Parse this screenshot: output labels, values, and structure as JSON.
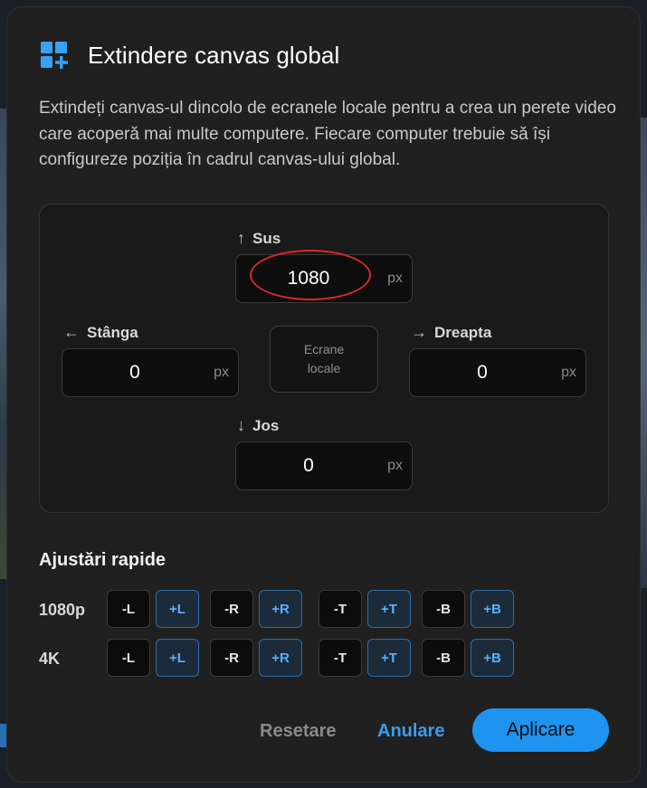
{
  "dialog": {
    "title": "Extindere canvas global",
    "description": "Extindeți canvas-ul dincolo de ecranele locale pentru a crea un perete video care acoperă mai multe computere. Fiecare computer trebuie să își configureze poziția în cadrul canvas-ului global."
  },
  "panel": {
    "top": {
      "label": "Sus",
      "value": "1080",
      "unit": "px",
      "arrow": "↑"
    },
    "left": {
      "label": "Stânga",
      "value": "0",
      "unit": "px",
      "arrow": "←"
    },
    "right": {
      "label": "Dreapta",
      "value": "0",
      "unit": "px",
      "arrow": "→"
    },
    "bottom": {
      "label": "Jos",
      "value": "0",
      "unit": "px",
      "arrow": "↓"
    },
    "center": {
      "line1": "Ecrane",
      "line2": "locale"
    }
  },
  "quick": {
    "title": "Ajustări rapide",
    "rows": [
      {
        "label": "1080p",
        "buttons": [
          "-L",
          "+L",
          "-R",
          "+R",
          "-T",
          "+T",
          "-B",
          "+B"
        ]
      },
      {
        "label": "4K",
        "buttons": [
          "-L",
          "+L",
          "-R",
          "+R",
          "-T",
          "+T",
          "-B",
          "+B"
        ]
      }
    ]
  },
  "footer": {
    "reset": "Resetare",
    "cancel": "Anulare",
    "apply": "Aplicare"
  },
  "colors": {
    "accent": "#1f93f0",
    "highlight": "#d9282b",
    "dialog_bg": "#202020"
  },
  "icons": {
    "title": "grid-add-icon"
  }
}
